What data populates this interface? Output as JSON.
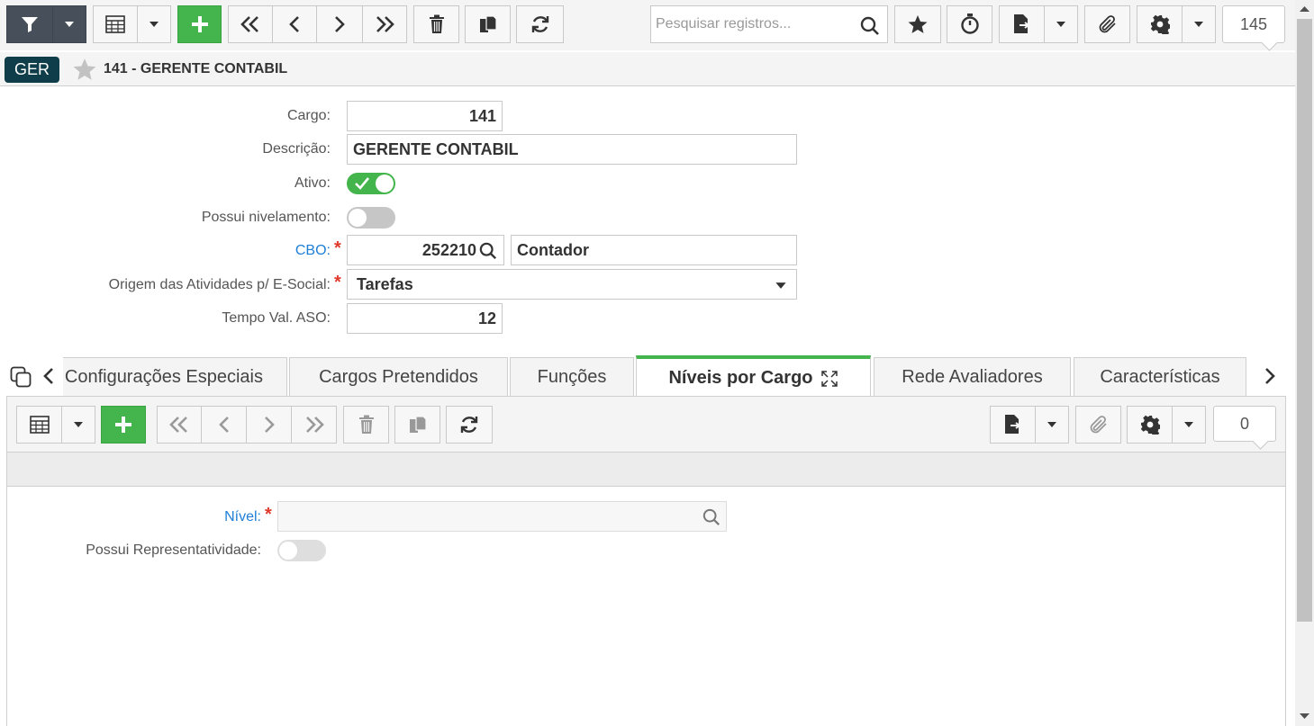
{
  "toolbar": {
    "search_placeholder": "Pesquisar registros...",
    "record_count": "145"
  },
  "header": {
    "badge": "GER",
    "title": "141 - GERENTE CONTABIL"
  },
  "form": {
    "cargo_label": "Cargo:",
    "cargo_value": "141",
    "descricao_label": "Descrição:",
    "descricao_value": "GERENTE CONTABIL",
    "ativo_label": "Ativo:",
    "ativo": true,
    "nivelamento_label": "Possui nivelamento:",
    "nivelamento": false,
    "cbo_label": "CBO:",
    "cbo_code": "252210",
    "cbo_desc": "Contador",
    "origem_label": "Origem das Atividades p/ E-Social:",
    "origem_value": "Tarefas",
    "tempo_label": "Tempo Val. ASO:",
    "tempo_value": "12",
    "required_mark": "*"
  },
  "tabs": [
    {
      "label": "Configurações Especiais"
    },
    {
      "label": "Cargos Pretendidos"
    },
    {
      "label": "Funções"
    },
    {
      "label": "Níveis por Cargo",
      "active": true
    },
    {
      "label": "Rede Avaliadores"
    },
    {
      "label": "Características"
    }
  ],
  "subform": {
    "record_count": "0",
    "nivel_label": "Nível:",
    "nivel_value": "",
    "representatividade_label": "Possui Representatividade:",
    "representatividade": false
  },
  "colors": {
    "accent_green": "#43b54c",
    "badge_bg": "#0f3d49",
    "link_blue": "#1f7ed6",
    "required_red": "#e0392c"
  }
}
